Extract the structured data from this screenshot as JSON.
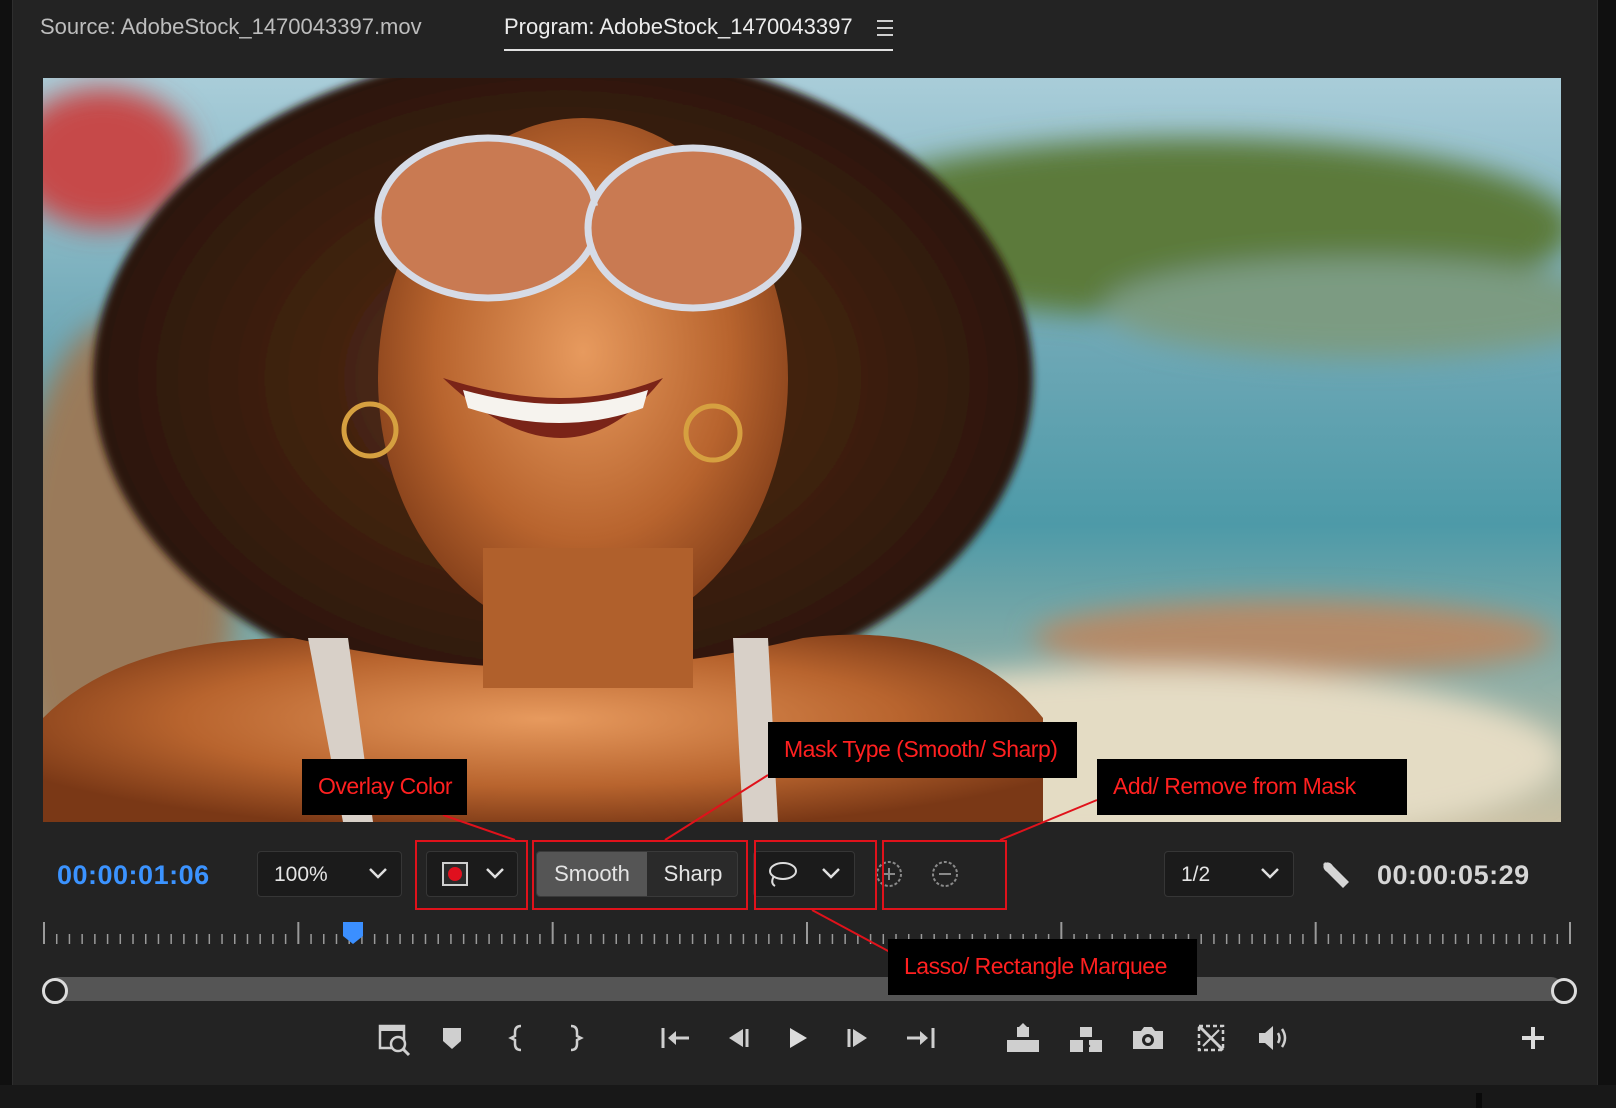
{
  "tabs": {
    "source": "Source: AdobeStock_1470043397.mov",
    "program": "Program: AdobeStock_1470043397"
  },
  "timecode": {
    "current": "00:00:01:06",
    "total": "00:00:05:29"
  },
  "zoom": {
    "value": "100%"
  },
  "resolution": {
    "value": "1/2"
  },
  "overlay_color": {
    "swatch": "#e0101e"
  },
  "mask_type": {
    "options": [
      "Smooth",
      "Sharp"
    ],
    "selected": "Smooth"
  },
  "callouts": {
    "overlay_color": "Overlay Color",
    "mask_type": "Mask Type (Smooth/ Sharp)",
    "add_remove": "Add/ Remove from Mask",
    "lasso": "Lasso/ Rectangle Marquee"
  },
  "colors": {
    "accent_blue": "#3b93ff",
    "highlight_red": "#e0121b",
    "panel_bg": "#232323"
  },
  "playhead_position": 0.203,
  "icons": [
    "menu-icon",
    "chevron-down-icon",
    "lasso-icon",
    "add-to-mask-icon",
    "remove-from-mask-icon",
    "wrench-icon",
    "marker-icon",
    "mark-in-icon",
    "mark-out-icon",
    "go-to-in-icon",
    "step-back-icon",
    "play-icon",
    "step-forward-icon",
    "go-to-out-icon",
    "lift-icon",
    "extract-icon",
    "camera-icon",
    "comparison-icon",
    "volume-icon",
    "plus-icon",
    "zoom-to-sequence-icon"
  ]
}
